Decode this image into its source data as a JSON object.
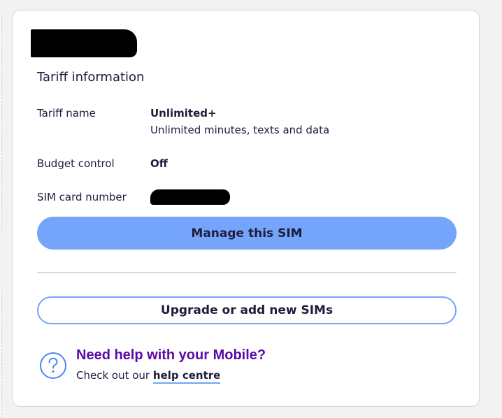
{
  "tariff_section": {
    "title": "Tariff information",
    "rows": [
      {
        "label": "Tariff name",
        "value": "Unlimited+",
        "sub": "Unlimited minutes, texts and data"
      },
      {
        "label": "Budget control",
        "value": "Off"
      },
      {
        "label": "SIM card number",
        "value": ""
      }
    ]
  },
  "buttons": {
    "manage": "Manage this SIM",
    "upgrade": "Upgrade or add new SIMs"
  },
  "help": {
    "icon": "question-circle-icon",
    "title": "Need help with your Mobile?",
    "text": "Check out our",
    "link": "help centre"
  },
  "colors": {
    "primary_button": "#74a5fa",
    "help_title": "#5a0aa5",
    "text": "#1f1d3d"
  }
}
